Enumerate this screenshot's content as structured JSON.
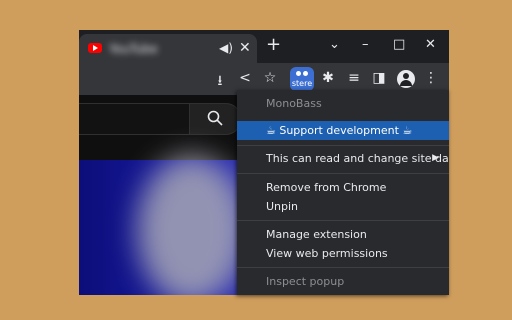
{
  "tab": {
    "title": "YouTube",
    "audio_icon": "◀)",
    "close_icon": "✕"
  },
  "new_tab_icon": "+",
  "window_controls": {
    "dropdown": "⌄",
    "minimize": "–",
    "maximize": "□",
    "close": "✕"
  },
  "toolbar": {
    "icons": [
      "install-icon",
      "share-icon",
      "bookmark-star-icon",
      "extension-badge-icon",
      "puzzle-extensions-icon",
      "reading-list-icon",
      "side-panel-icon",
      "profile-icon",
      "kebab-menu-icon"
    ],
    "install_glyph": "⭳",
    "share_glyph": "<",
    "star_glyph": "☆",
    "puzzle_glyph": "✱",
    "reading_glyph": "≡",
    "panel_glyph": "◨",
    "kebab_glyph": "⋮",
    "extension_badge_text": "stere"
  },
  "menu": {
    "header": "MonoBass",
    "items": [
      {
        "label": "☕ Support development ☕",
        "selected": true
      },
      {
        "label": "This can read and change site data",
        "has_submenu": true
      },
      {
        "label": "Remove from Chrome"
      },
      {
        "label": "Unpin"
      },
      {
        "label": "Manage extension"
      },
      {
        "label": "View web permissions"
      },
      {
        "label": "Inspect popup",
        "disabled": true
      }
    ],
    "submenu_arrow": "▶"
  },
  "colors": {
    "background": "#cf9d5c",
    "menu_bg": "#292a2d",
    "selection": "#1d5fb0",
    "extension_badge": "#3c6fd1"
  }
}
